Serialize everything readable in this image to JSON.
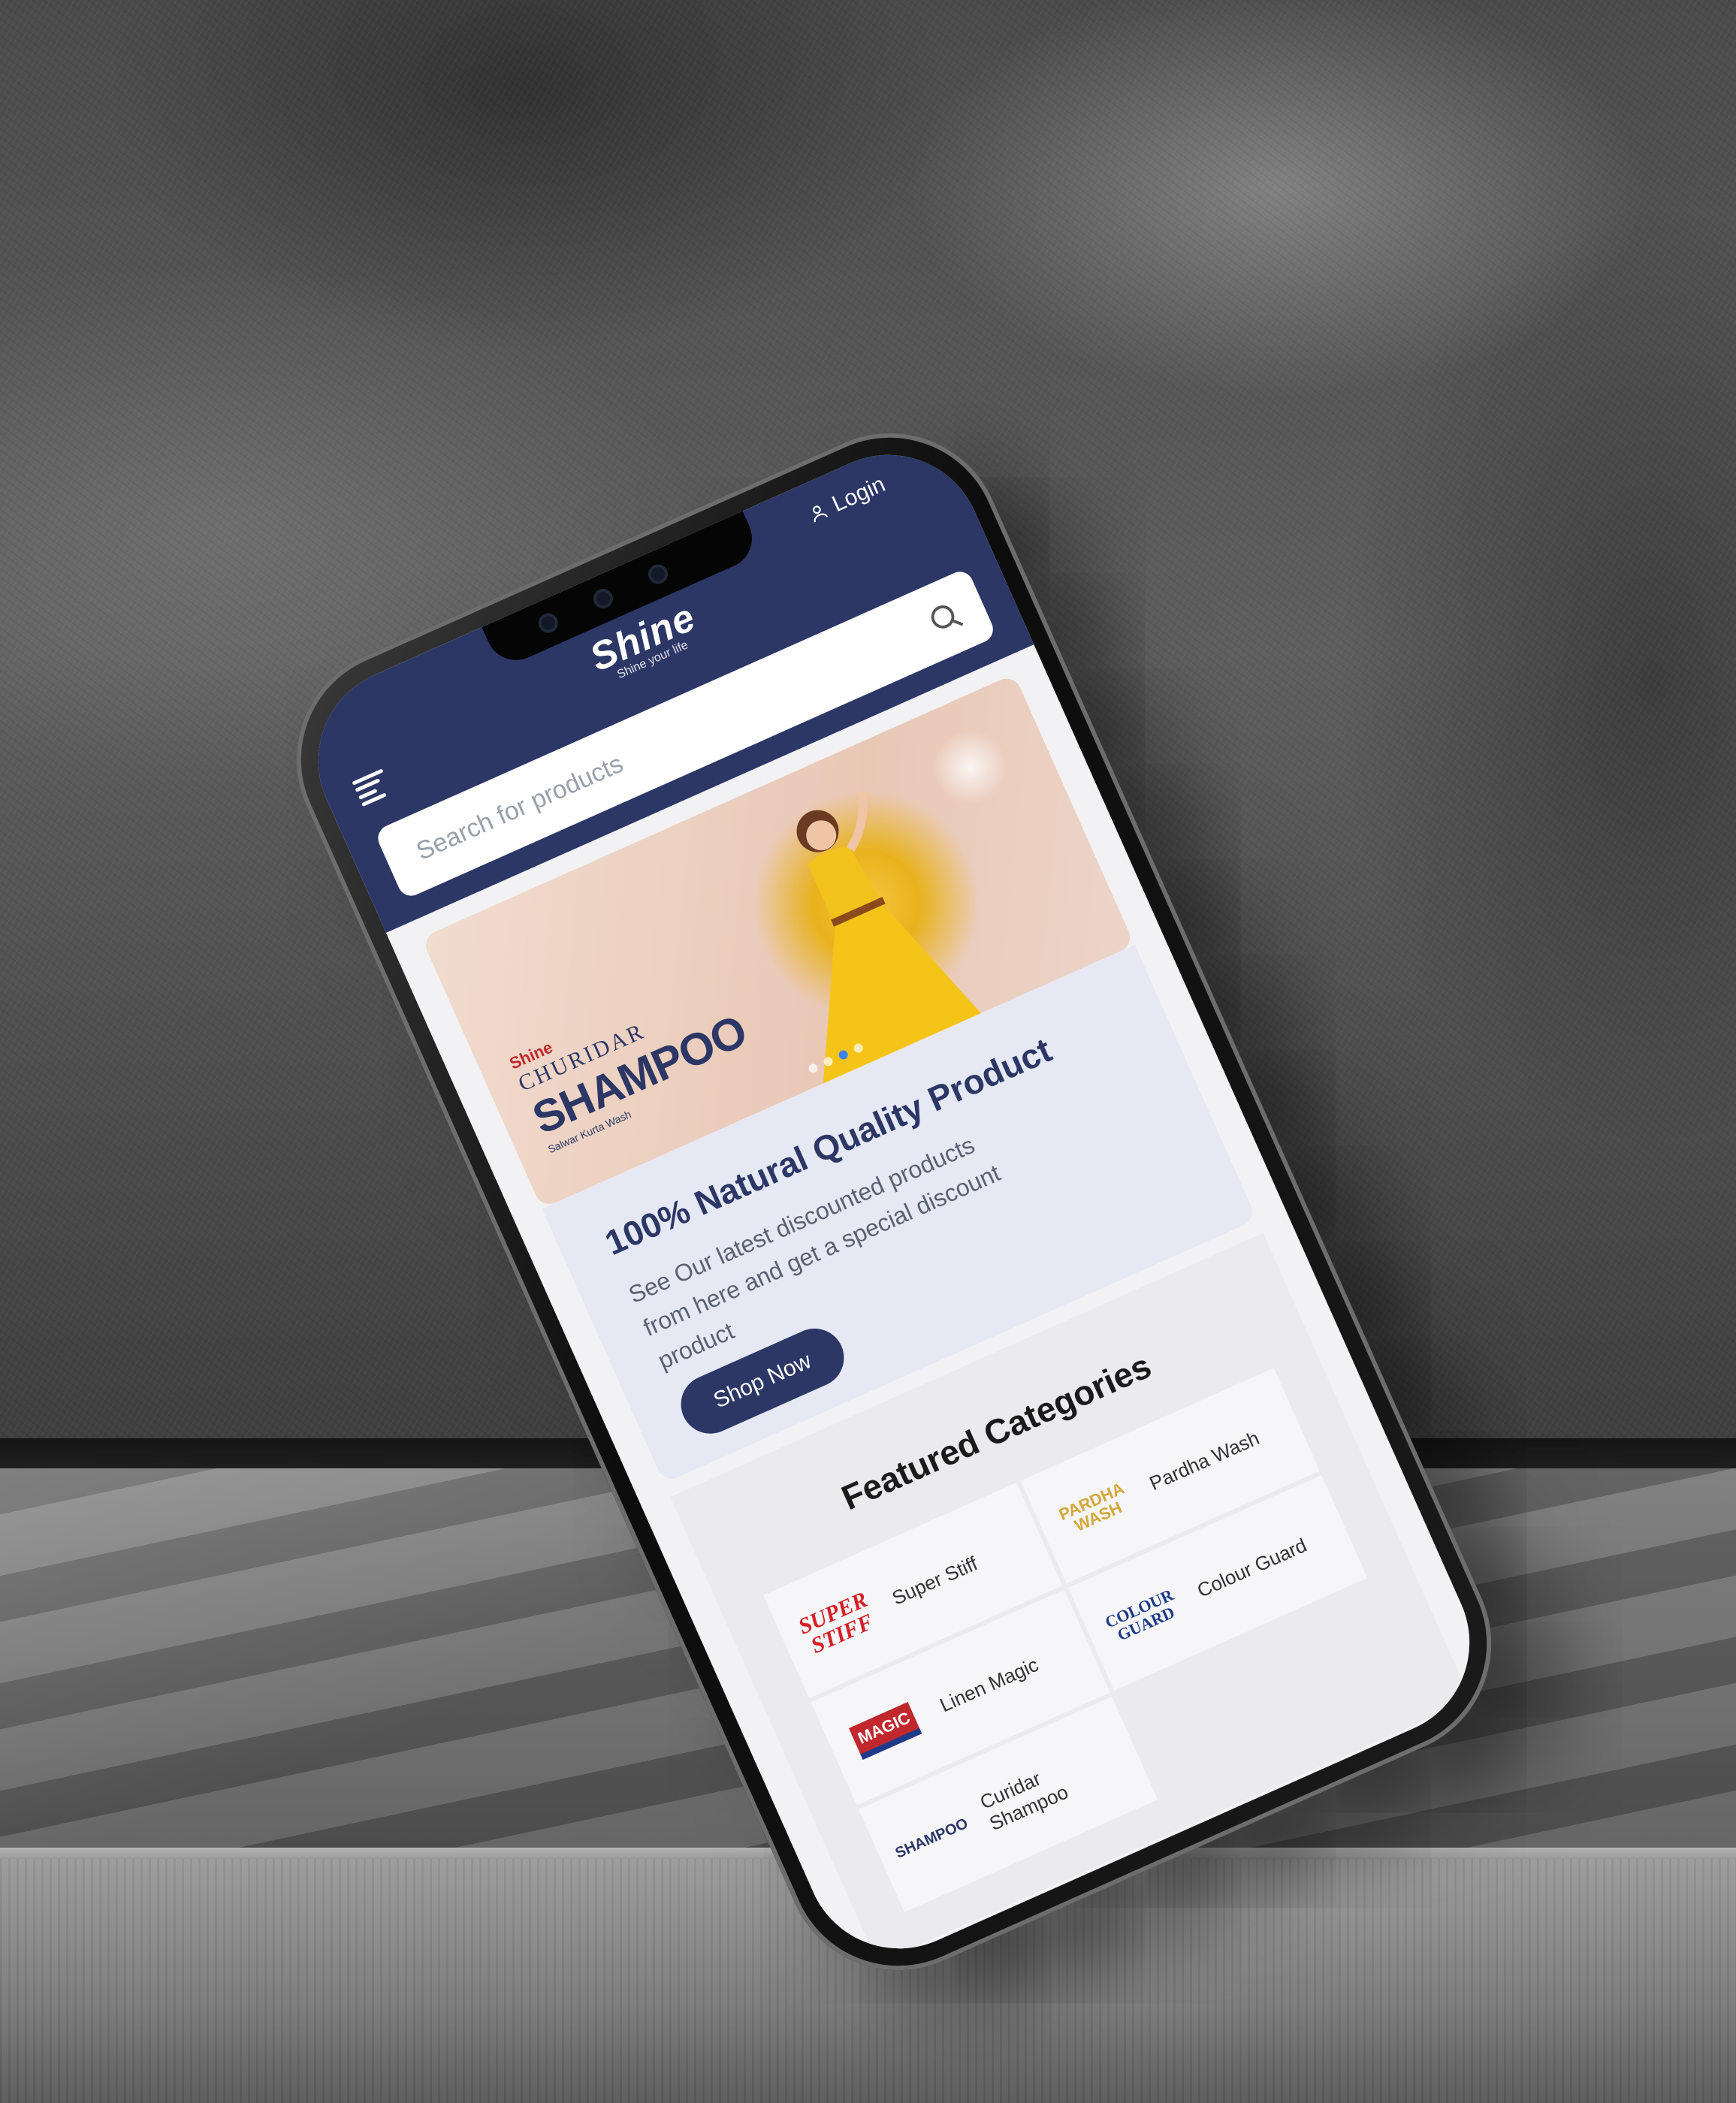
{
  "header": {
    "login_label": "Login",
    "logo_text": "Shine",
    "logo_tagline": "Shine your life"
  },
  "search": {
    "placeholder": "Search for products"
  },
  "hero": {
    "brand_small": "Shine",
    "brand_line": "CHURIDAR",
    "brand_big": "SHAMPOO",
    "brand_sub": "Salwar Kurta Wash",
    "slides_total": 4,
    "active_slide": 3
  },
  "promo": {
    "title": "100% Natural Quality Product",
    "text": "See Our latest discounted products from here and get a special discount product",
    "button_label": "Shop Now"
  },
  "featured": {
    "title": "Featured Categories",
    "categories": [
      {
        "name": "Super Stiff",
        "logo": "SUPER STIFF"
      },
      {
        "name": "Pardha Wash",
        "logo": "PARDHA WASH"
      },
      {
        "name": "Linen Magic",
        "logo": "MAGIC"
      },
      {
        "name": "Colour Guard",
        "logo": "COLOUR GUARD"
      },
      {
        "name": "Curidar Shampoo",
        "logo": "SHAMPOO"
      }
    ]
  },
  "colors": {
    "primary": "#2c3766",
    "promo_bg": "#e6e9f4",
    "accent": "#3b82f6"
  }
}
